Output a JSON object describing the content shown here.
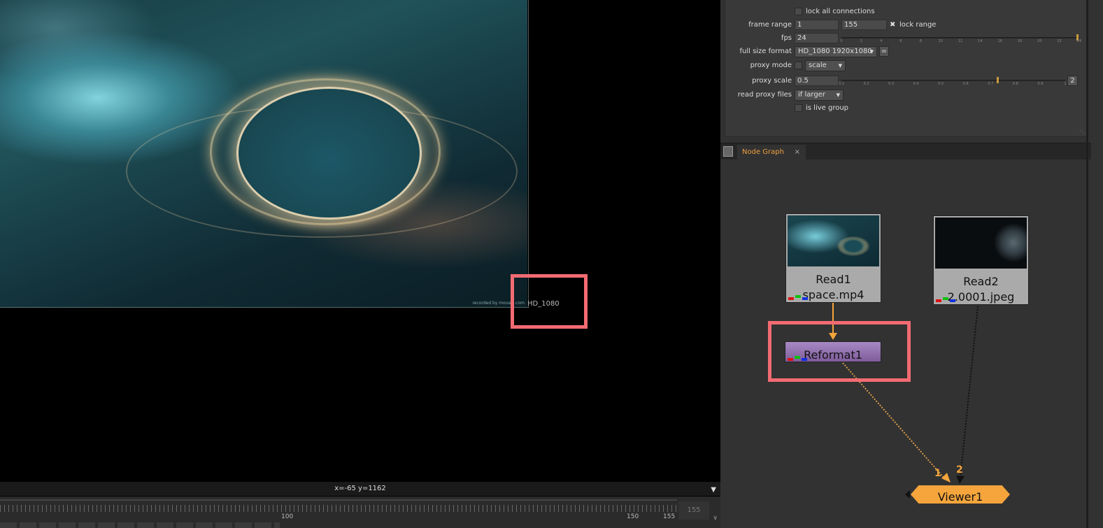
{
  "viewer": {
    "format_label": "HD_1080",
    "watermark": "recorded by movavi.com",
    "coords": "x=-65 y=1162",
    "timeline": {
      "label_100": "100",
      "label_150": "150",
      "label_155": "155",
      "end_frame": "155"
    }
  },
  "properties": {
    "lock_all_connections": "lock all connections",
    "frame_range_label": "frame range",
    "frame_range_start": "1",
    "frame_range_end": "155",
    "lock_range": "lock range",
    "fps_label": "fps",
    "fps_value": "24",
    "fps_ticks": [
      "0",
      "2",
      "4",
      "6",
      "8",
      "10",
      "12",
      "14",
      "16",
      "18",
      "20",
      "22",
      "24"
    ],
    "full_size_format_label": "full size format",
    "full_size_format_value": "HD_1080 1920x1080",
    "format_edit_btn": "=",
    "proxy_mode_label": "proxy mode",
    "proxy_mode_value": "scale",
    "proxy_scale_label": "proxy scale",
    "proxy_scale_value": "0.5",
    "proxy_scale_ticks": [
      "0.1",
      "0.2",
      "0.3",
      "0.4",
      "0.5",
      "0.6",
      "0.7",
      "0.8",
      "0.9",
      "1"
    ],
    "proxy_scale_btn": "2",
    "read_proxy_files_label": "read proxy files",
    "read_proxy_files_value": "if larger",
    "is_live_group": "is live group"
  },
  "node_graph": {
    "tab_label": "Node Graph",
    "tab_close": "×",
    "read1": {
      "name": "Read1",
      "file": "space.mp4"
    },
    "read2": {
      "name": "Read2",
      "file": "2.0001.jpeg"
    },
    "reformat": {
      "name": "Reformat1"
    },
    "viewer": {
      "name": "Viewer1",
      "input1": "1",
      "input2": "2"
    }
  },
  "colors": {
    "highlight": "#f26b72",
    "tab_text": "#f0a040",
    "viewer_node": "#f5a53c",
    "reformat_node": "#9b78b8"
  }
}
